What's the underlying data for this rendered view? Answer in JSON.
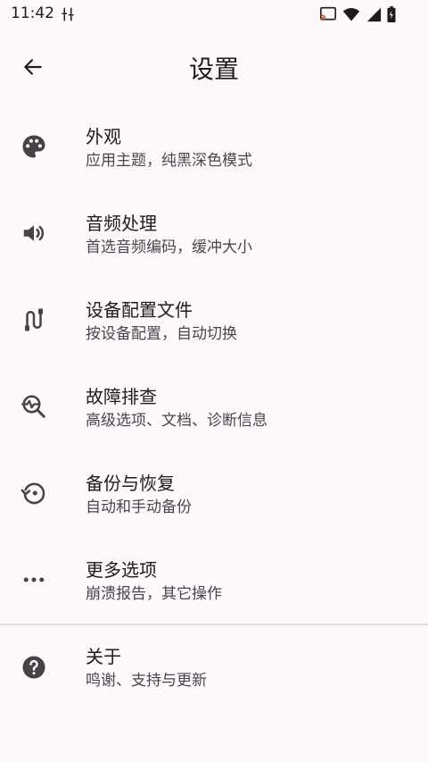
{
  "status": {
    "time": "11:42"
  },
  "header": {
    "title": "设置"
  },
  "items": [
    {
      "title": "外观",
      "subtitle": "应用主题，纯黑深色模式",
      "icon": "palette-icon"
    },
    {
      "title": "音频处理",
      "subtitle": "首选音频编码，缓冲大小",
      "icon": "volume-icon"
    },
    {
      "title": "设备配置文件",
      "subtitle": "按设备配置，自动切换",
      "icon": "device-profile-icon"
    },
    {
      "title": "故障排查",
      "subtitle": "高级选项、文档、诊断信息",
      "icon": "troubleshoot-icon"
    },
    {
      "title": "备份与恢复",
      "subtitle": "自动和手动备份",
      "icon": "backup-restore-icon"
    },
    {
      "title": "更多选项",
      "subtitle": "崩溃报告，其它操作",
      "icon": "more-horiz-icon"
    },
    {
      "title": "关于",
      "subtitle": "鸣谢、支持与更新",
      "icon": "help-icon"
    }
  ],
  "colors": {
    "background": "#fdf8fa",
    "text": "#1c1b1f",
    "subtext": "#49454f",
    "icon": "#454348"
  }
}
